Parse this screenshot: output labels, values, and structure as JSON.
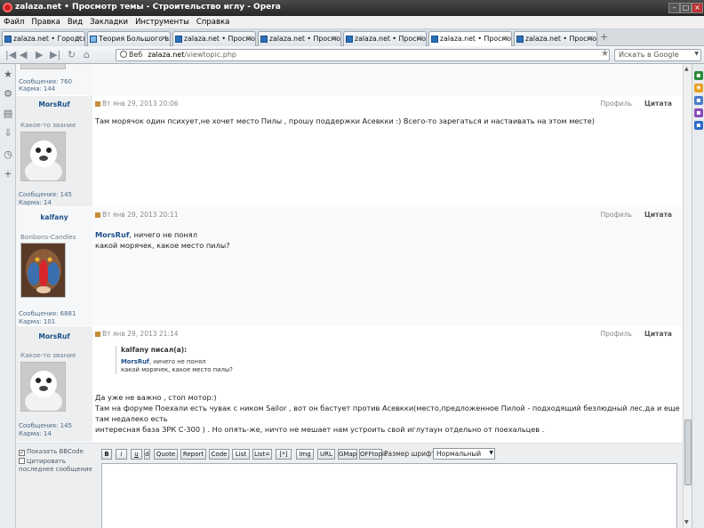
{
  "window": {
    "title": "zalaza.net • Просмотр темы - Строительство иглу - Opera"
  },
  "menu": [
    "Файл",
    "Правка",
    "Вид",
    "Закладки",
    "Инструменты",
    "Справка"
  ],
  "tabs": [
    {
      "label": "zalaza.net • Городские и..."
    },
    {
      "label": "Теория Большого взры..."
    },
    {
      "label": "zalaza.net • Просмотр ф..."
    },
    {
      "label": "zalaza.net • Просмотр т..."
    },
    {
      "label": "zalaza.net • Просмотр т..."
    },
    {
      "label": "zalaza.net • Просмотр т..."
    },
    {
      "label": "zalaza.net • Просмотр т..."
    }
  ],
  "address": {
    "prefix": "Веб",
    "domain": "zalaza.net",
    "path": "/viewtopic.php",
    "search_placeholder": "Искать в Google"
  },
  "prev_post": {
    "messages_label": "Сообщения:",
    "messages": "760",
    "karma_label": "Карма:",
    "karma": "144"
  },
  "posts": [
    {
      "author": "MorsRuf",
      "rank": "Какое-то звание",
      "date": "Вт янв 29, 2013 20:06",
      "profile": "Профиль",
      "quote_btn": "Цитата",
      "text": "Там морячок один психует,не хочет место Пилы , прошу поддержки Асевкки :) Всего-то зарегаться и настаивать на этом месте)",
      "messages_label": "Сообщения:",
      "messages": "145",
      "karma_label": "Карма:",
      "karma": "14"
    },
    {
      "author": "kalfany",
      "rank": "Bonbons-Candies",
      "date": "Вт янв 29, 2013 20:11",
      "profile": "Профиль",
      "quote_btn": "Цитата",
      "mention": "MorsRuf",
      "line1": ", ничего не понял",
      "line2": "какой морячек, какое место пилы?",
      "messages_label": "Сообщения:",
      "messages": "6881",
      "karma_label": "Карма:",
      "karma": "101"
    },
    {
      "author": "MorsRuf",
      "rank": "Какое-то звание",
      "date": "Вт янв 29, 2013 21:14",
      "profile": "Профиль",
      "quote_btn": "Цитата",
      "quote_head": "kalfany писал(а):",
      "quote_mention": "MorsRuf",
      "quote_line1": ", ничего не понял",
      "quote_line2": "какой морячек, какое место пилы?",
      "line1": "Да уже не важно , стоп мотор:)",
      "line2": "Там на форуме Поехали есть чувак с ником Sailor , вот он бастует против Асевкки(место,предложенное Пилой - подходящий безлюдный лес,да и еще там недалеко есть",
      "line3": "интересная база ЗРК С-300 ) . Но опять-же, ничто не мешает нам устроить свой иглутаун отдельно от поехальцев .",
      "messages_label": "Сообщения:",
      "messages": "145",
      "karma_label": "Карма:",
      "karma": "14"
    }
  ],
  "editor": {
    "show_bbcode": "Показать BBCode",
    "cite_last": "Цитировать последнее сообщение",
    "buttons": [
      "B",
      "i",
      "u",
      "Quote",
      "Report",
      "Code",
      "List",
      "List=",
      "[*]",
      "Img",
      "URL",
      "GMap",
      "OFFtopic"
    ],
    "font_size_label": "Размер шрифта:",
    "font_size_value": "Нормальный"
  }
}
